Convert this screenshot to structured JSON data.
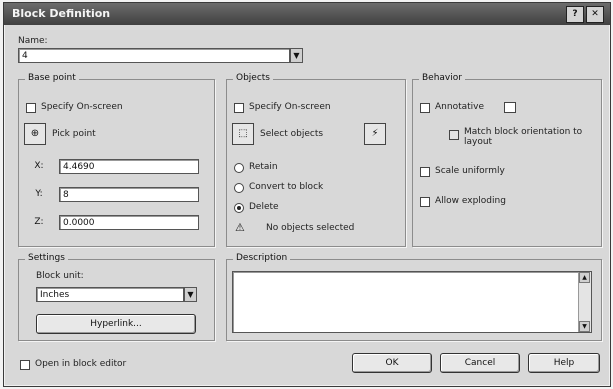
{
  "window": {
    "title": "Block Definition",
    "help_glyph": "?",
    "close_glyph": "✕"
  },
  "name": {
    "label": "Name:",
    "value": "4",
    "dropdown_glyph": "▼"
  },
  "base_point": {
    "title": "Base point",
    "specify_on_screen": "Specify On-screen",
    "pick_point": "Pick point",
    "x_label": "X:",
    "x_value": "4.4690",
    "y_label": "Y:",
    "y_value": "8",
    "z_label": "Z:",
    "z_value": "0.0000"
  },
  "objects": {
    "title": "Objects",
    "specify_on_screen": "Specify On-screen",
    "select_objects": "Select objects",
    "retain": "Retain",
    "convert_to_block": "Convert to block",
    "delete": "Delete",
    "no_objects_selected": "No objects selected"
  },
  "behavior": {
    "title": "Behavior",
    "annotative": "Annotative",
    "match_orientation": "Match block orientation to layout",
    "scale_uniformly": "Scale uniformly",
    "allow_exploding": "Allow exploding"
  },
  "settings": {
    "title": "Settings",
    "block_unit_label": "Block unit:",
    "block_unit_value": "Inches",
    "hyperlink_label": "Hyperlink..."
  },
  "description": {
    "title": "Description"
  },
  "footer": {
    "open_in_block_editor": "Open in block editor",
    "ok": "OK",
    "cancel": "Cancel",
    "help": "Help"
  },
  "icons": {
    "pick_point": "⊕",
    "select_objects": "⬚",
    "quick_select": "⚡",
    "warning": "⚠"
  }
}
